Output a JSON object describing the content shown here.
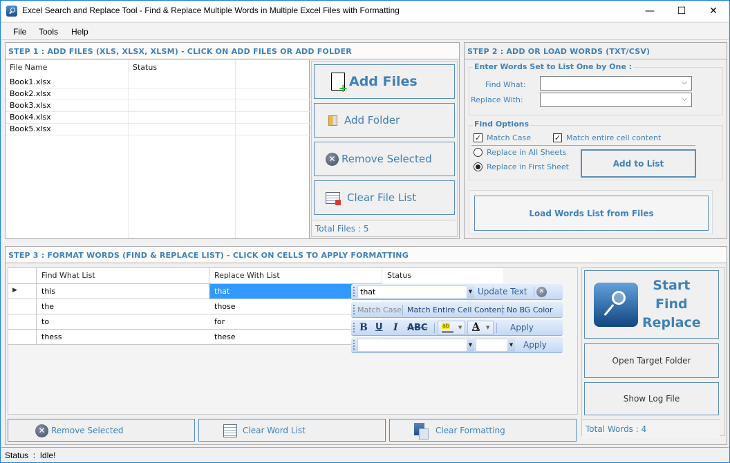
{
  "window": {
    "title": "Excel Search and Replace Tool - Find & Replace Multiple Words in Multiple Excel Files with Formatting",
    "minimize": "—",
    "maximize": "☐",
    "close": "✕"
  },
  "menu": [
    "File",
    "Tools",
    "Help"
  ],
  "step1": {
    "heading": "STEP 1 : ADD FILES (XLS, XLSX, XLSM) - CLICK ON ADD FILES OR ADD FOLDER",
    "columns": [
      "File Name",
      "Status",
      ""
    ],
    "files": [
      "Book1.xlsx",
      "Book2.xlsx",
      "Book3.xlsx",
      "Book4.xlsx",
      "Book5.xlsx"
    ],
    "buttons": {
      "add_files": "Add Files",
      "add_folder": "Add Folder",
      "remove_selected": "Remove Selected",
      "clear_file_list": "Clear File List"
    },
    "total_files": "Total Files : 5"
  },
  "step2": {
    "heading": "STEP 2 : ADD OR LOAD WORDS (TXT/CSV)",
    "group_words": "Enter Words Set to List One by One :",
    "find_what_label": "Find What:",
    "find_what_value": "",
    "replace_with_label": "Replace With:",
    "replace_with_value": "",
    "group_options": "Find Options",
    "match_case": {
      "label": "Match Case",
      "checked": true
    },
    "match_entire": {
      "label": "Match entire cell content",
      "checked": true
    },
    "replace_all_sheets": {
      "label": "Replace in All Sheets",
      "selected": false
    },
    "replace_first_sheet": {
      "label": "Replace in First Sheet",
      "selected": true
    },
    "add_to_list": "Add to List",
    "load_words": "Load Words List from Files"
  },
  "step3": {
    "heading": "STEP 3 : FORMAT WORDS (FIND & REPLACE LIST) - CLICK ON CELLS TO APPLY FORMATTING",
    "columns": [
      "Find What List",
      "Replace With List",
      "Status"
    ],
    "rows": [
      {
        "find": "this",
        "replace": "that",
        "status": ""
      },
      {
        "find": "the",
        "replace": "those",
        "status": ""
      },
      {
        "find": "to",
        "replace": "for",
        "status": ""
      },
      {
        "find": "thess",
        "replace": "these",
        "status": ""
      }
    ],
    "toolbar": {
      "edit_value": "that",
      "update_text": "Update Text",
      "match_case": "Match Case",
      "match_entire": "Match Entire Cell Content",
      "no_bg_color": "No BG Color",
      "bold": "B",
      "underline": "U",
      "italic": "I",
      "strike": "ABC",
      "highlight_glyph": "ab",
      "font_color_glyph": "A",
      "apply1": "Apply",
      "font_name": "",
      "font_size": "",
      "apply2": "Apply"
    },
    "buttons": {
      "remove_selected": "Remove Selected",
      "clear_word_list": "Clear Word List",
      "clear_formatting": "Clear Formatting"
    }
  },
  "side": {
    "start_line1": "Start",
    "start_line2": "Find",
    "start_line3": "Replace",
    "open_target": "Open Target Folder",
    "show_log": "Show Log File",
    "total_words": "Total Words : 4"
  },
  "status": "Status  :  Idle!"
}
